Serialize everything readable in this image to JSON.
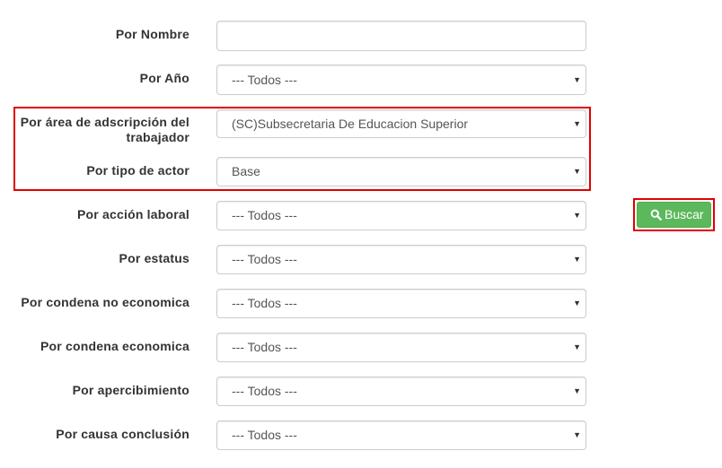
{
  "filters": [
    {
      "label": "Por Nombre",
      "value": "",
      "type": "text"
    },
    {
      "label": "Por Año",
      "value": "--- Todos ---",
      "type": "select"
    },
    {
      "label": "Por área de adscripción del trabajador",
      "value": "(SC)Subsecretaria De Educacion Superior",
      "type": "select"
    },
    {
      "label": "Por tipo de actor",
      "value": "Base",
      "type": "select"
    },
    {
      "label": "Por acción laboral",
      "value": "--- Todos ---",
      "type": "select"
    },
    {
      "label": "Por estatus",
      "value": "--- Todos ---",
      "type": "select"
    },
    {
      "label": "Por condena no economica",
      "value": "--- Todos ---",
      "type": "select"
    },
    {
      "label": "Por condena economica",
      "value": "--- Todos ---",
      "type": "select"
    },
    {
      "label": "Por apercibimiento",
      "value": "--- Todos ---",
      "type": "select"
    },
    {
      "label": "Por causa conclusión",
      "value": "--- Todos ---",
      "type": "select"
    }
  ],
  "search_button": {
    "label": "Buscar",
    "icon": "search-icon",
    "color": "#5cb85c"
  },
  "highlight_color": "#e00000"
}
